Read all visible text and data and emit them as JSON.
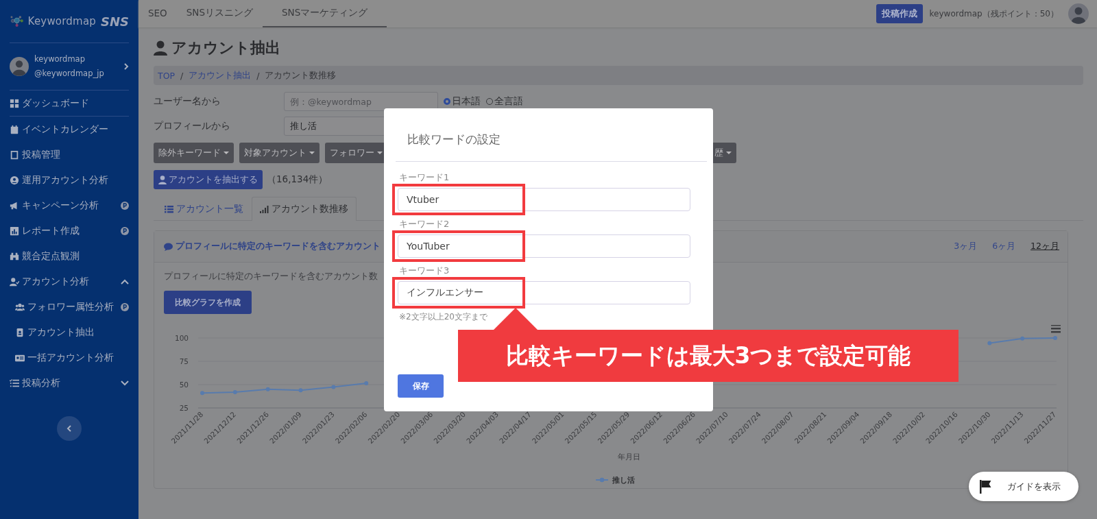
{
  "sidebar": {
    "logo": {
      "brand": "Keywordmap",
      "product": "SNS"
    },
    "user": {
      "name": "keywordmap",
      "handle": "@keywordmap_jp"
    },
    "items": [
      {
        "label": "ダッシュボード"
      },
      {
        "label": "イベントカレンダー"
      },
      {
        "label": "投稿管理"
      },
      {
        "label": "運用アカウント分析"
      },
      {
        "label": "キャンペーン分析",
        "badge": "P"
      },
      {
        "label": "レポート作成",
        "badge": "P"
      },
      {
        "label": "競合定点観測"
      },
      {
        "label": "アカウント分析",
        "expanded": true,
        "children": [
          {
            "label": "フォロワー属性分析",
            "badge": "P"
          },
          {
            "label": "アカウント抽出"
          },
          {
            "label": "一括アカウント分析"
          }
        ]
      },
      {
        "label": "投稿分析",
        "expanded": false
      }
    ]
  },
  "topbar": {
    "tabs": [
      {
        "label": "SEO",
        "selected": false
      },
      {
        "label": "SNSリスニング",
        "selected": false
      },
      {
        "label": "SNSマーケティング",
        "selected": true
      }
    ],
    "post_button": "投稿作成",
    "account": "keywordmap（残ポイント：50）"
  },
  "page": {
    "title": "アカウント抽出",
    "breadcrumb_separator": "/",
    "breadcrumb": [
      {
        "label": "TOP",
        "link": true
      },
      {
        "label": "アカウント抽出",
        "link": true
      },
      {
        "label": "アカウント数推移",
        "link": false
      }
    ]
  },
  "form": {
    "username": {
      "label": "ユーザー名から",
      "placeholder": "例：@keywordmap"
    },
    "language": [
      {
        "label": "日本語",
        "selected": true
      },
      {
        "label": "全言語",
        "selected": false
      }
    ],
    "profile": {
      "label": "プロフィールから",
      "value": "推し活"
    },
    "filters": [
      "除外キーワード",
      "対象アカウント",
      "フォロワー",
      "歴"
    ],
    "extract_button": "アカウントを抽出する",
    "result_count": "（16,134件）"
  },
  "view_tabs": [
    {
      "label": "アカウント一覧",
      "selected": false
    },
    {
      "label": "アカウント数推移",
      "selected": true
    }
  ],
  "card": {
    "title": "プロフィールに特定のキーワードを含むアカウント",
    "periods": [
      {
        "label": "3ヶ月",
        "selected": false
      },
      {
        "label": "6ヶ月",
        "selected": false
      },
      {
        "label": "12ヶ月",
        "selected": true
      }
    ],
    "description": "プロフィールに特定のキーワードを含むアカウント数",
    "compare_button": "比較グラフを作成",
    "chart_data": {
      "type": "line",
      "xlabel": "年月日",
      "categories": [
        "2021/11/28",
        "2021/12/12",
        "2021/12/26",
        "2022/01/09",
        "2022/01/23",
        "2022/02/06",
        "2022/02/20",
        "2022/03/06",
        "2022/03/20",
        "2022/04/03",
        "2022/04/17",
        "2022/05/01",
        "2022/05/15",
        "2022/05/29",
        "2022/06/12",
        "2022/06/26",
        "2022/07/10",
        "2022/07/24",
        "2022/08/07",
        "2022/08/21",
        "2022/09/04",
        "2022/09/18",
        "2022/10/02",
        "2022/10/16",
        "2022/10/30",
        "2022/11/13",
        "2022/11/27"
      ],
      "series": [
        {
          "name": "推し活",
          "color": "#587bad",
          "marker": "circle",
          "values": [
            41,
            42,
            45,
            44,
            47.5,
            51.5,
            null,
            null,
            null,
            null,
            null,
            null,
            null,
            null,
            null,
            null,
            null,
            null,
            null,
            null,
            null,
            null,
            null,
            null,
            94.5,
            99.5,
            100
          ]
        }
      ],
      "ylim": [
        25,
        100
      ],
      "yticks": [
        25,
        50,
        75,
        100
      ]
    }
  },
  "modal": {
    "title": "比較ワードの設定",
    "keywords": [
      {
        "label": "キーワード1",
        "value": "Vtuber",
        "highlighted": true
      },
      {
        "label": "キーワード2",
        "value": "YouTuber",
        "highlighted": true
      },
      {
        "label": "キーワード3",
        "value": "インフルエンサー",
        "highlighted": true
      }
    ],
    "hint": "※2文字以上20文字まで",
    "save_button": "保存"
  },
  "callout": {
    "text": "比較キーワードは最大3つまで設定可能"
  },
  "guide_button": "ガイドを表示"
}
